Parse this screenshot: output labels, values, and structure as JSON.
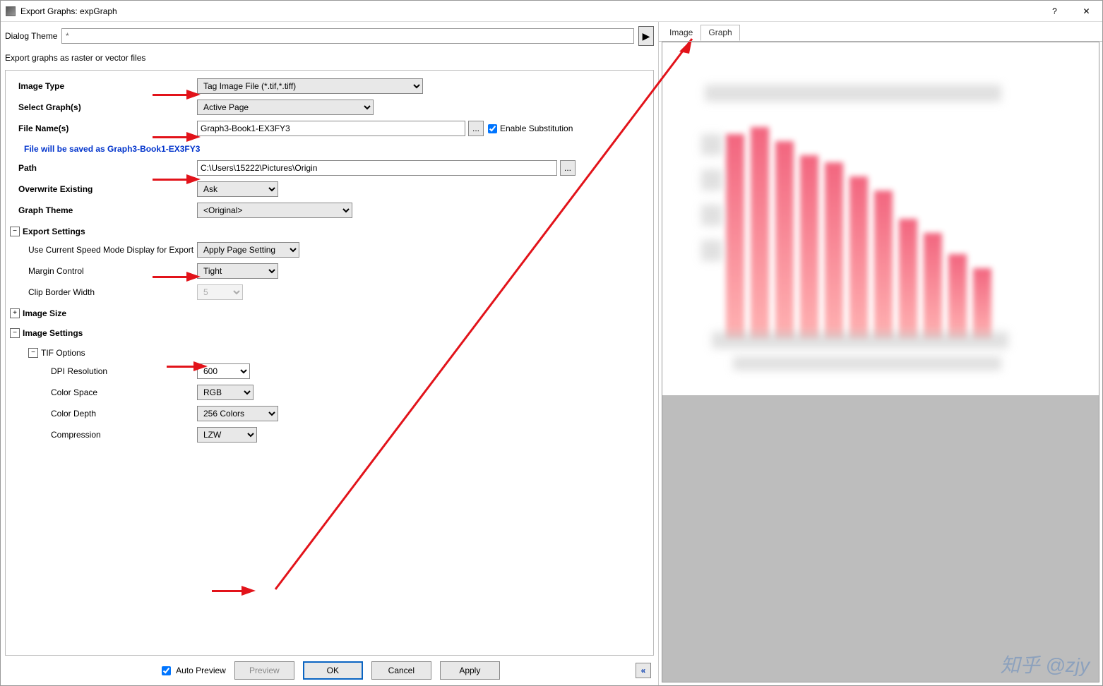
{
  "window": {
    "title": "Export Graphs: expGraph",
    "help": "?",
    "close": "✕"
  },
  "themeRow": {
    "label": "Dialog Theme",
    "value": "*"
  },
  "subtitle": "Export graphs as raster or vector files",
  "form": {
    "imageType": {
      "label": "Image Type",
      "value": "Tag Image File (*.tif,*.tiff)"
    },
    "selectGraphs": {
      "label": "Select Graph(s)",
      "value": "Active Page"
    },
    "fileNames": {
      "label": "File Name(s)",
      "value": "Graph3-Book1-EX3FY3",
      "browse": "...",
      "enableSub": "Enable Substitution"
    },
    "savedAs": "File will be saved as Graph3-Book1-EX3FY3",
    "path": {
      "label": "Path",
      "value": "C:\\Users\\15222\\Pictures\\Origin",
      "browse": "..."
    },
    "overwrite": {
      "label": "Overwrite Existing",
      "value": "Ask"
    },
    "graphTheme": {
      "label": "Graph Theme",
      "value": "<Original>"
    },
    "exportSettings": {
      "label": "Export Settings",
      "speedMode": {
        "label": "Use Current Speed Mode Display for Export",
        "value": "Apply Page Setting"
      },
      "margin": {
        "label": "Margin Control",
        "value": "Tight"
      },
      "clip": {
        "label": "Clip Border Width",
        "value": "5"
      }
    },
    "imageSize": {
      "label": "Image Size"
    },
    "imageSettings": {
      "label": "Image Settings",
      "tifOptions": {
        "label": "TIF Options",
        "dpi": {
          "label": "DPI Resolution",
          "value": "600"
        },
        "colorSpace": {
          "label": "Color Space",
          "value": "RGB"
        },
        "colorDepth": {
          "label": "Color Depth",
          "value": "256 Colors"
        },
        "compression": {
          "label": "Compression",
          "value": "LZW"
        }
      }
    }
  },
  "buttons": {
    "autoPreview": "Auto Preview",
    "preview": "Preview",
    "ok": "OK",
    "cancel": "Cancel",
    "apply": "Apply",
    "chevrons": "«"
  },
  "tabs": {
    "image": "Image",
    "graph": "Graph"
  },
  "watermark": "知乎 @zjy"
}
